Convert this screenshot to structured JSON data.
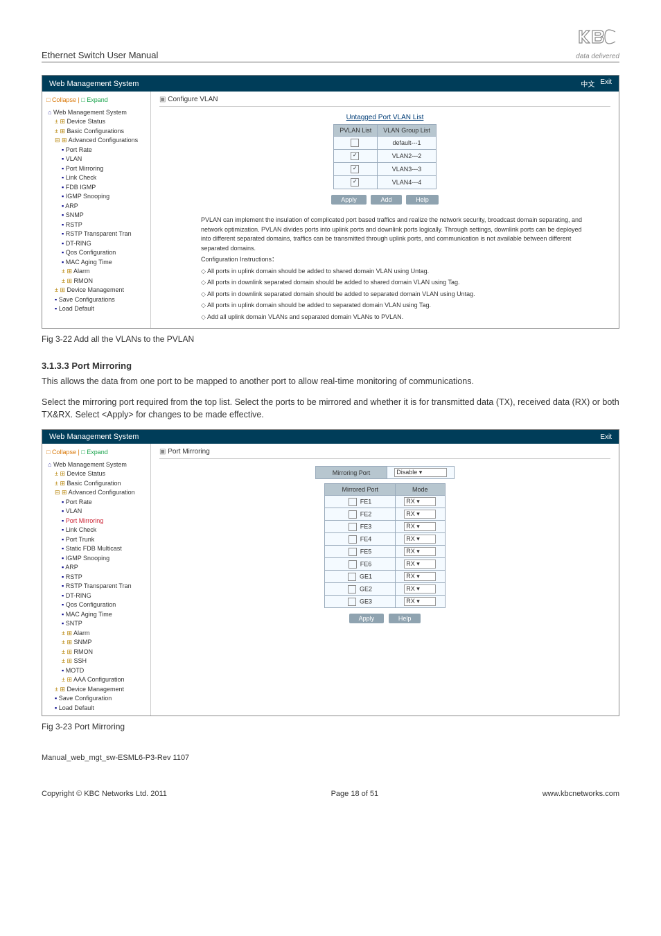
{
  "header": {
    "doc_title": "Ethernet Switch User Manual",
    "logo_tag": "data delivered"
  },
  "shot1": {
    "bar": {
      "title": "Web Management System",
      "lang": "中文",
      "exit": "Exit"
    },
    "side": {
      "collapse_label": "Collapse",
      "expand_label": "Expand",
      "top": "Web Management System",
      "items": [
        "Device Status",
        "Basic Configurations",
        "Advanced Configurations"
      ],
      "adv_children": [
        "Port Rate",
        "VLAN",
        "Port Mirroring",
        "Link Check",
        "FDB IGMP",
        "IGMP Snooping",
        "ARP",
        "SNMP",
        "RSTP",
        "RSTP Transparent Tran",
        "DT-RING",
        "Qos Configuration",
        "MAC Aging Time",
        "Alarm",
        "RMON"
      ],
      "after": [
        "Device Management",
        "Save Configurations",
        "Load Default"
      ]
    },
    "crumb": "Configure VLAN",
    "list_title": "Untagged Port VLAN List",
    "table": {
      "headers": [
        "PVLAN List",
        "VLAN Group List"
      ],
      "rows": [
        [
          "",
          "default---1"
        ],
        [
          "✓",
          "VLAN2---2"
        ],
        [
          "✓",
          "VLAN3---3"
        ],
        [
          "✓",
          "VLAN4---4"
        ]
      ]
    },
    "buttons": [
      "Apply",
      "Add",
      "Help"
    ],
    "instructions_para": "PVLAN can implement the insulation of complicated port based traffics and realize the network security, broadcast domain separating, and network optimization. PVLAN divides ports into uplink ports and downlink ports logically. Through settings, downlink ports can be deployed into different separated domains, traffics can be transmitted through uplink ports, and communication is not available between different separated domains.",
    "conf_title": "Configuration Instructions：",
    "instructions": [
      "All ports in uplink domain should be added to shared domain VLAN using Untag.",
      "All ports in downlink separated domain should be added to shared domain VLAN using Tag.",
      "All ports in downlink separated domain should be added to separated domain VLAN using Untag.",
      "All ports in uplink domain should be added to separated domain VLAN using Tag.",
      "Add all uplink domain VLANs and separated domain VLANs to PVLAN."
    ]
  },
  "caption1": "Fig 3-22 Add all the VLANs to the PVLAN",
  "sec313": {
    "title": "3.1.3.3 Port Mirroring",
    "p1": "This allows the data from one port to be mapped to another port to allow real-time monitoring of communications.",
    "p2": "Select the mirroring port required from the top list. Select the ports to be mirrored and whether it is for transmitted data (TX), received data (RX) or both TX&RX. Select <Apply> for changes to be made effective."
  },
  "shot2": {
    "bar": {
      "title": "Web Management System",
      "exit": "Exit"
    },
    "side": {
      "collapse_label": "Collapse",
      "expand_label": "Expand",
      "top": "Web Management System",
      "items": [
        "Device Status",
        "Basic Configuration",
        "Advanced Configuration"
      ],
      "adv_children": [
        "Port Rate",
        "VLAN",
        "Port Mirroring",
        "Link Check",
        "Port Trunk",
        "Static FDB Multicast",
        "IGMP Snooping",
        "ARP",
        "RSTP",
        "RSTP Transparent Tran",
        "DT-RING",
        "Qos Configuration",
        "MAC Aging Time",
        "SNTP",
        "Alarm",
        "SNMP",
        "RMON",
        "SSH",
        "MOTD",
        "AAA Configuration"
      ],
      "after": [
        "Device Management",
        "Save Configuration",
        "Load Default"
      ]
    },
    "crumb": "Port Mirroring",
    "top_row": {
      "label": "Mirroring Port",
      "value": "Disable"
    },
    "table": {
      "headers": [
        "Mirrored Port",
        "Mode"
      ],
      "rows": [
        [
          "FE1",
          "RX"
        ],
        [
          "FE2",
          "RX"
        ],
        [
          "FE3",
          "RX"
        ],
        [
          "FE4",
          "RX"
        ],
        [
          "FE5",
          "RX"
        ],
        [
          "FE6",
          "RX"
        ],
        [
          "GE1",
          "RX"
        ],
        [
          "GE2",
          "RX"
        ],
        [
          "GE3",
          "RX"
        ]
      ]
    },
    "buttons": [
      "Apply",
      "Help"
    ]
  },
  "caption2": "Fig 3-23 Port Mirroring",
  "manual_ref": "Manual_web_mgt_sw-ESML6-P3-Rev 1107",
  "footer": {
    "left": "Copyright © KBC Networks Ltd. 2011",
    "center": "Page 18 of 51",
    "right": "www.kbcnetworks.com"
  }
}
